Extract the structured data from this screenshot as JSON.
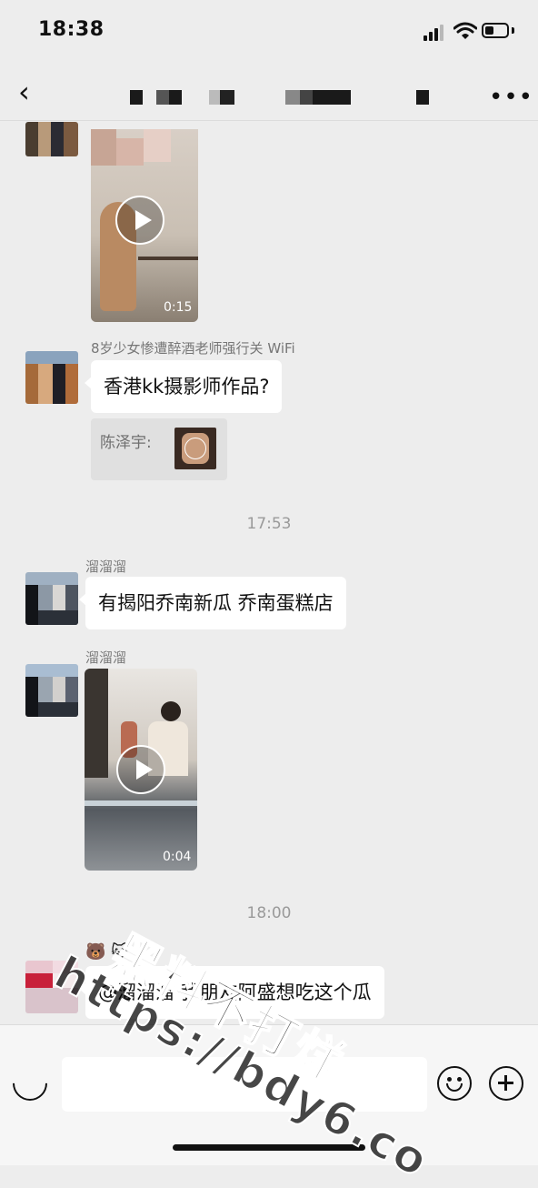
{
  "status": {
    "time": "18:38"
  },
  "nav": {
    "back_glyph": "‹",
    "more_glyph": "•••"
  },
  "messages": {
    "video1": {
      "duration": "0:15"
    },
    "msg2": {
      "quoted_header": "8岁少女惨遭醉酒老师强行关 WiFi",
      "text": "香港kk摄影师作品?",
      "reply_label": "陈泽宇:"
    },
    "timestamp1": "17:53",
    "msg3": {
      "sender": "溜溜溜",
      "text": "有揭阳乔南新瓜  乔南蛋糕店"
    },
    "msg4": {
      "sender": "溜溜溜",
      "duration": "0:04"
    },
    "timestamp2": "18:00",
    "msg5": {
      "sender_emoji": "🐻 🐱",
      "text": "@溜溜溜 我朋友阿盛想吃这个瓜"
    }
  },
  "input": {
    "placeholder": ""
  },
  "watermark": {
    "line1": "黑料不打烊",
    "line2": "https://bdy6.co"
  },
  "icons": {
    "signal": "cellular-signal-icon",
    "wifi": "wifi-icon",
    "battery": "battery-icon",
    "voice": "voice-icon",
    "emoji": "emoji-icon",
    "plus": "plus-icon"
  }
}
